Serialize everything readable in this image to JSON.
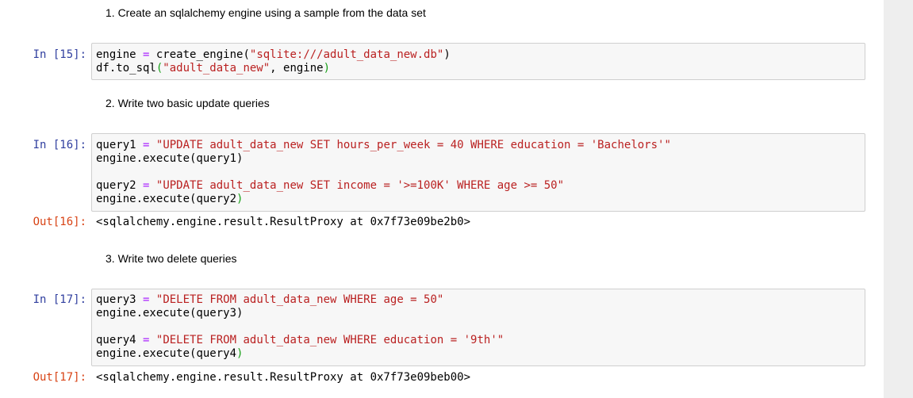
{
  "markdown": {
    "step1": "1. Create an sqlalchemy engine using a sample from the data set",
    "step2": "2. Write two basic update queries",
    "step3": "3. Write two delete queries"
  },
  "cells": {
    "c15": {
      "prompt": "In [15]:",
      "l1a": "engine ",
      "l1b": "=",
      "l1c": " create_engine(",
      "l1d": "\"sqlite:///adult_data_new.db\"",
      "l1e": ")",
      "l2a": "df.to_sql",
      "l2b": "(",
      "l2c": "\"adult_data_new\"",
      "l2d": ", engine",
      "l2e": ")"
    },
    "c16": {
      "prompt": "In [16]:",
      "l1a": "query1 ",
      "l1b": "=",
      "l1c": " ",
      "l1d": "\"UPDATE adult_data_new SET hours_per_week = 40 WHERE education = 'Bachelors'\"",
      "l2a": "engine.execute(query1)",
      "l4a": "query2 ",
      "l4b": "=",
      "l4c": " ",
      "l4d": "\"UPDATE adult_data_new SET income = '>=100K' WHERE age >= 50\"",
      "l5a": "engine.execute",
      "l5b": "(",
      "l5c": "query2",
      "l5d": ")",
      "out_prompt": "Out[16]:",
      "output": "<sqlalchemy.engine.result.ResultProxy at 0x7f73e09be2b0>"
    },
    "c17": {
      "prompt": "In [17]:",
      "l1a": "query3 ",
      "l1b": "=",
      "l1c": " ",
      "l1d": "\"DELETE FROM adult_data_new WHERE age = 50\"",
      "l2a": "engine.execute(query3)",
      "l4a": "query4 ",
      "l4b": "=",
      "l4c": " ",
      "l4d": "\"DELETE FROM adult_data_new WHERE education = '9th'\"",
      "l5a": "engine.execute",
      "l5b": "(",
      "l5c": "query4",
      "l5d": ")",
      "out_prompt": "Out[17]:",
      "output": "<sqlalchemy.engine.result.ResultProxy at 0x7f73e09beb00>"
    }
  }
}
